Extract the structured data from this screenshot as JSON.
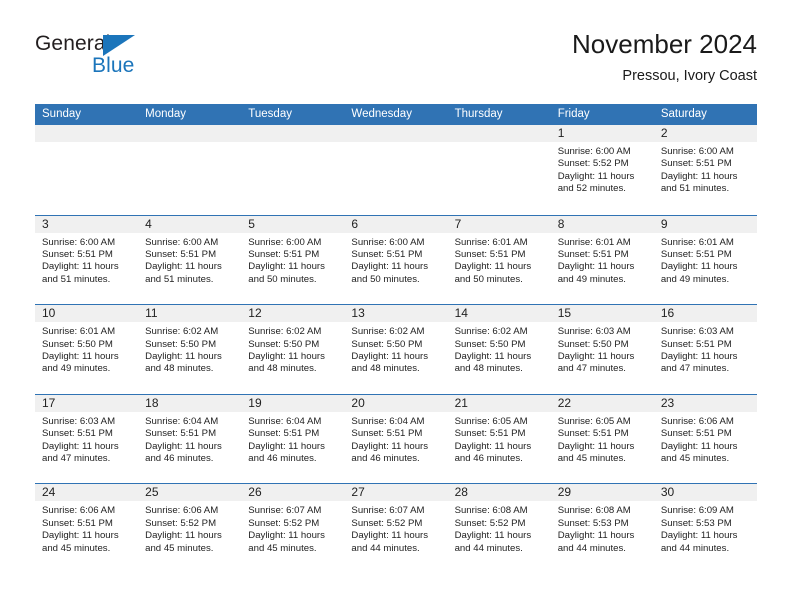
{
  "brand": {
    "name_top": "General",
    "name_bottom": "Blue",
    "triangle_color": "#1b75bb"
  },
  "header": {
    "title": "November 2024",
    "subtitle": "Pressou, Ivory Coast"
  },
  "theme": {
    "header_blue": "#3073b4",
    "day_band_gray": "#f0f0f0",
    "text_color": "#222222"
  },
  "weekdays": [
    "Sunday",
    "Monday",
    "Tuesday",
    "Wednesday",
    "Thursday",
    "Friday",
    "Saturday"
  ],
  "weeks": [
    [
      {
        "day": "",
        "empty": true,
        "sunrise": "",
        "sunset": "",
        "daylight_line1": "",
        "daylight_line2": ""
      },
      {
        "day": "",
        "empty": true,
        "sunrise": "",
        "sunset": "",
        "daylight_line1": "",
        "daylight_line2": ""
      },
      {
        "day": "",
        "empty": true,
        "sunrise": "",
        "sunset": "",
        "daylight_line1": "",
        "daylight_line2": ""
      },
      {
        "day": "",
        "empty": true,
        "sunrise": "",
        "sunset": "",
        "daylight_line1": "",
        "daylight_line2": ""
      },
      {
        "day": "",
        "empty": true,
        "sunrise": "",
        "sunset": "",
        "daylight_line1": "",
        "daylight_line2": ""
      },
      {
        "day": "1",
        "empty": false,
        "sunrise": "Sunrise: 6:00 AM",
        "sunset": "Sunset: 5:52 PM",
        "daylight_line1": "Daylight: 11 hours",
        "daylight_line2": "and 52 minutes."
      },
      {
        "day": "2",
        "empty": false,
        "sunrise": "Sunrise: 6:00 AM",
        "sunset": "Sunset: 5:51 PM",
        "daylight_line1": "Daylight: 11 hours",
        "daylight_line2": "and 51 minutes."
      }
    ],
    [
      {
        "day": "3",
        "empty": false,
        "sunrise": "Sunrise: 6:00 AM",
        "sunset": "Sunset: 5:51 PM",
        "daylight_line1": "Daylight: 11 hours",
        "daylight_line2": "and 51 minutes."
      },
      {
        "day": "4",
        "empty": false,
        "sunrise": "Sunrise: 6:00 AM",
        "sunset": "Sunset: 5:51 PM",
        "daylight_line1": "Daylight: 11 hours",
        "daylight_line2": "and 51 minutes."
      },
      {
        "day": "5",
        "empty": false,
        "sunrise": "Sunrise: 6:00 AM",
        "sunset": "Sunset: 5:51 PM",
        "daylight_line1": "Daylight: 11 hours",
        "daylight_line2": "and 50 minutes."
      },
      {
        "day": "6",
        "empty": false,
        "sunrise": "Sunrise: 6:00 AM",
        "sunset": "Sunset: 5:51 PM",
        "daylight_line1": "Daylight: 11 hours",
        "daylight_line2": "and 50 minutes."
      },
      {
        "day": "7",
        "empty": false,
        "sunrise": "Sunrise: 6:01 AM",
        "sunset": "Sunset: 5:51 PM",
        "daylight_line1": "Daylight: 11 hours",
        "daylight_line2": "and 50 minutes."
      },
      {
        "day": "8",
        "empty": false,
        "sunrise": "Sunrise: 6:01 AM",
        "sunset": "Sunset: 5:51 PM",
        "daylight_line1": "Daylight: 11 hours",
        "daylight_line2": "and 49 minutes."
      },
      {
        "day": "9",
        "empty": false,
        "sunrise": "Sunrise: 6:01 AM",
        "sunset": "Sunset: 5:51 PM",
        "daylight_line1": "Daylight: 11 hours",
        "daylight_line2": "and 49 minutes."
      }
    ],
    [
      {
        "day": "10",
        "empty": false,
        "sunrise": "Sunrise: 6:01 AM",
        "sunset": "Sunset: 5:50 PM",
        "daylight_line1": "Daylight: 11 hours",
        "daylight_line2": "and 49 minutes."
      },
      {
        "day": "11",
        "empty": false,
        "sunrise": "Sunrise: 6:02 AM",
        "sunset": "Sunset: 5:50 PM",
        "daylight_line1": "Daylight: 11 hours",
        "daylight_line2": "and 48 minutes."
      },
      {
        "day": "12",
        "empty": false,
        "sunrise": "Sunrise: 6:02 AM",
        "sunset": "Sunset: 5:50 PM",
        "daylight_line1": "Daylight: 11 hours",
        "daylight_line2": "and 48 minutes."
      },
      {
        "day": "13",
        "empty": false,
        "sunrise": "Sunrise: 6:02 AM",
        "sunset": "Sunset: 5:50 PM",
        "daylight_line1": "Daylight: 11 hours",
        "daylight_line2": "and 48 minutes."
      },
      {
        "day": "14",
        "empty": false,
        "sunrise": "Sunrise: 6:02 AM",
        "sunset": "Sunset: 5:50 PM",
        "daylight_line1": "Daylight: 11 hours",
        "daylight_line2": "and 48 minutes."
      },
      {
        "day": "15",
        "empty": false,
        "sunrise": "Sunrise: 6:03 AM",
        "sunset": "Sunset: 5:50 PM",
        "daylight_line1": "Daylight: 11 hours",
        "daylight_line2": "and 47 minutes."
      },
      {
        "day": "16",
        "empty": false,
        "sunrise": "Sunrise: 6:03 AM",
        "sunset": "Sunset: 5:51 PM",
        "daylight_line1": "Daylight: 11 hours",
        "daylight_line2": "and 47 minutes."
      }
    ],
    [
      {
        "day": "17",
        "empty": false,
        "sunrise": "Sunrise: 6:03 AM",
        "sunset": "Sunset: 5:51 PM",
        "daylight_line1": "Daylight: 11 hours",
        "daylight_line2": "and 47 minutes."
      },
      {
        "day": "18",
        "empty": false,
        "sunrise": "Sunrise: 6:04 AM",
        "sunset": "Sunset: 5:51 PM",
        "daylight_line1": "Daylight: 11 hours",
        "daylight_line2": "and 46 minutes."
      },
      {
        "day": "19",
        "empty": false,
        "sunrise": "Sunrise: 6:04 AM",
        "sunset": "Sunset: 5:51 PM",
        "daylight_line1": "Daylight: 11 hours",
        "daylight_line2": "and 46 minutes."
      },
      {
        "day": "20",
        "empty": false,
        "sunrise": "Sunrise: 6:04 AM",
        "sunset": "Sunset: 5:51 PM",
        "daylight_line1": "Daylight: 11 hours",
        "daylight_line2": "and 46 minutes."
      },
      {
        "day": "21",
        "empty": false,
        "sunrise": "Sunrise: 6:05 AM",
        "sunset": "Sunset: 5:51 PM",
        "daylight_line1": "Daylight: 11 hours",
        "daylight_line2": "and 46 minutes."
      },
      {
        "day": "22",
        "empty": false,
        "sunrise": "Sunrise: 6:05 AM",
        "sunset": "Sunset: 5:51 PM",
        "daylight_line1": "Daylight: 11 hours",
        "daylight_line2": "and 45 minutes."
      },
      {
        "day": "23",
        "empty": false,
        "sunrise": "Sunrise: 6:06 AM",
        "sunset": "Sunset: 5:51 PM",
        "daylight_line1": "Daylight: 11 hours",
        "daylight_line2": "and 45 minutes."
      }
    ],
    [
      {
        "day": "24",
        "empty": false,
        "sunrise": "Sunrise: 6:06 AM",
        "sunset": "Sunset: 5:51 PM",
        "daylight_line1": "Daylight: 11 hours",
        "daylight_line2": "and 45 minutes."
      },
      {
        "day": "25",
        "empty": false,
        "sunrise": "Sunrise: 6:06 AM",
        "sunset": "Sunset: 5:52 PM",
        "daylight_line1": "Daylight: 11 hours",
        "daylight_line2": "and 45 minutes."
      },
      {
        "day": "26",
        "empty": false,
        "sunrise": "Sunrise: 6:07 AM",
        "sunset": "Sunset: 5:52 PM",
        "daylight_line1": "Daylight: 11 hours",
        "daylight_line2": "and 45 minutes."
      },
      {
        "day": "27",
        "empty": false,
        "sunrise": "Sunrise: 6:07 AM",
        "sunset": "Sunset: 5:52 PM",
        "daylight_line1": "Daylight: 11 hours",
        "daylight_line2": "and 44 minutes."
      },
      {
        "day": "28",
        "empty": false,
        "sunrise": "Sunrise: 6:08 AM",
        "sunset": "Sunset: 5:52 PM",
        "daylight_line1": "Daylight: 11 hours",
        "daylight_line2": "and 44 minutes."
      },
      {
        "day": "29",
        "empty": false,
        "sunrise": "Sunrise: 6:08 AM",
        "sunset": "Sunset: 5:53 PM",
        "daylight_line1": "Daylight: 11 hours",
        "daylight_line2": "and 44 minutes."
      },
      {
        "day": "30",
        "empty": false,
        "sunrise": "Sunrise: 6:09 AM",
        "sunset": "Sunset: 5:53 PM",
        "daylight_line1": "Daylight: 11 hours",
        "daylight_line2": "and 44 minutes."
      }
    ]
  ]
}
